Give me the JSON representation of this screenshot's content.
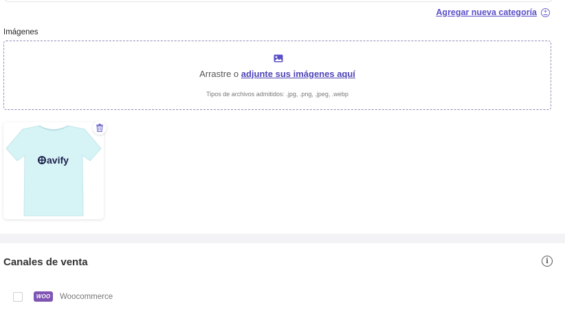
{
  "categories": {
    "add_label": "Agregar nueva categoría"
  },
  "images": {
    "label": "Imágenes",
    "drop_prefix": "Arrastre o ",
    "drop_link": "adjunte sus imágenes aquí",
    "file_types": "Tipos de archivos admitidos: .jpg, .png, .jpeg, .webp",
    "thumbnail": {
      "brand": "avify",
      "icon": "tshirt-image"
    }
  },
  "channels": {
    "title": "Canales de venta",
    "items": [
      {
        "logo": "WOO",
        "label": "Woocommerce",
        "checked": false
      }
    ]
  },
  "colors": {
    "accent": "#4e44b8",
    "woo_purple": "#7f54b3"
  }
}
